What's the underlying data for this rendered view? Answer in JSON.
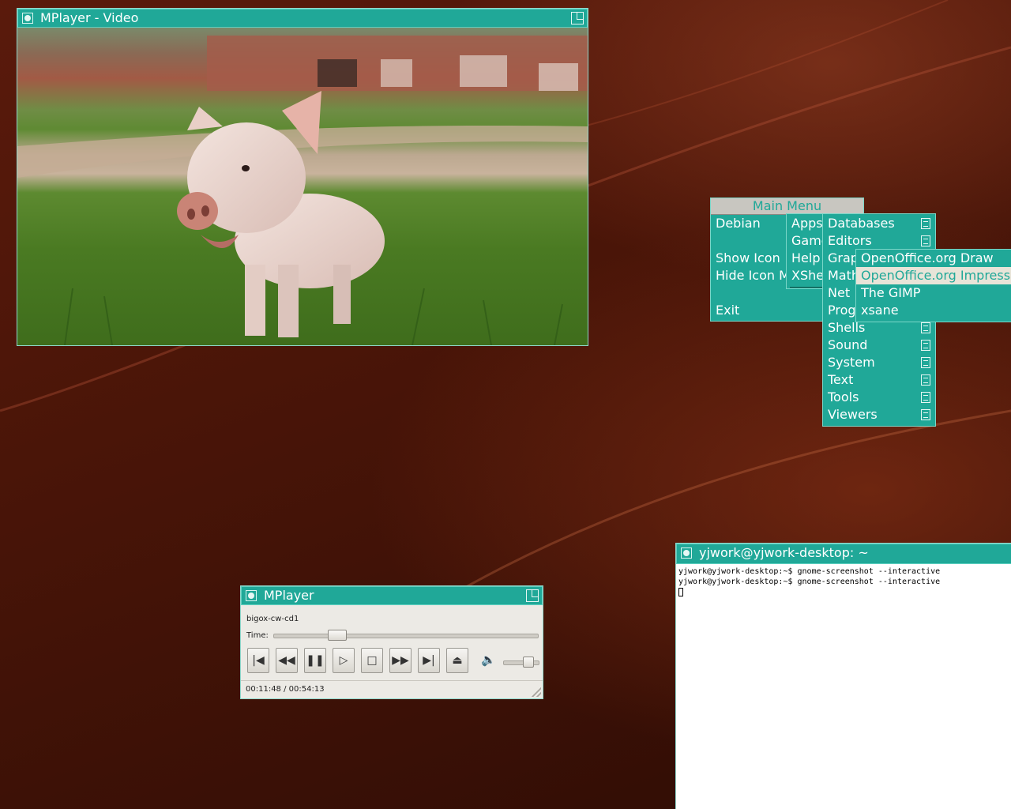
{
  "video_window": {
    "title": "MPlayer - Video"
  },
  "main_menu": {
    "title": "Main Menu",
    "items": [
      "Debian",
      "Show Icon",
      "Hide Icon M",
      "Exit"
    ]
  },
  "debian_menu": {
    "items": [
      "Apps",
      "Game",
      "Help",
      "XShe"
    ]
  },
  "apps_menu": {
    "items": [
      "Databases",
      "Editors",
      "Grap",
      "Math",
      "Net",
      "Prog",
      "Shells",
      "Sound",
      "System",
      "Text",
      "Tools",
      "Viewers"
    ]
  },
  "graphics_menu": {
    "items": [
      "OpenOffice.org Draw",
      "OpenOffice.org Impress",
      "The GIMP",
      "xsane"
    ],
    "selected": "OpenOffice.org Impress"
  },
  "player_window": {
    "title": "MPlayer",
    "file_name": "bigox-cw-cd1",
    "time_label": "Time:",
    "time_current": "00:11:48",
    "time_separator": "/",
    "time_total": "00:54:13",
    "seek_fraction": 0.22,
    "volume_fraction": 0.8
  },
  "terminal_window": {
    "title": "yjwork@yjwork-desktop: ~",
    "lines": [
      "yjwork@yjwork-desktop:~$ gnome-screenshot --interactive",
      "yjwork@yjwork-desktop:~$ gnome-screenshot --interactive"
    ]
  },
  "colors": {
    "accent": "#20a898",
    "desktop": "#4a1508"
  }
}
